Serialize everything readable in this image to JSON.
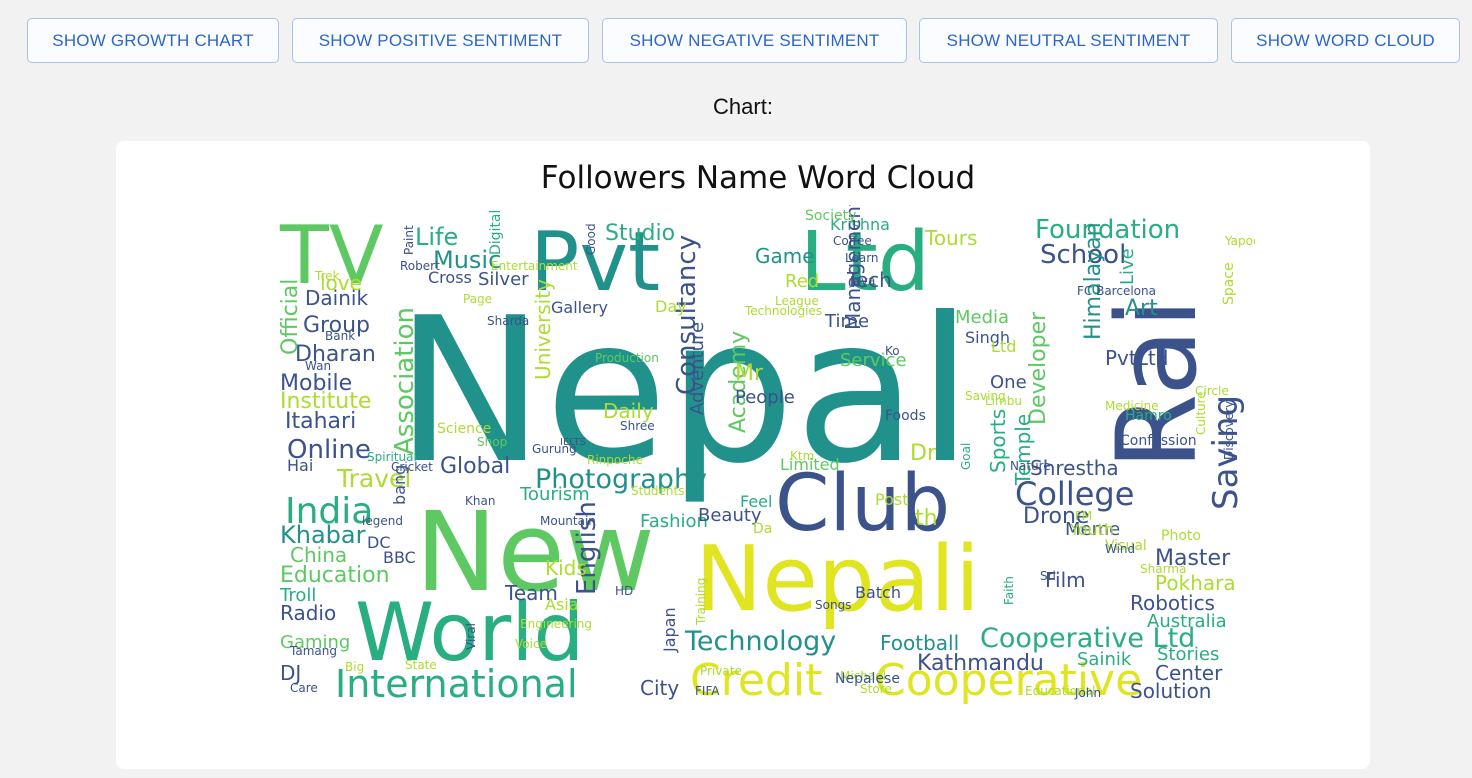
{
  "toolbar": {
    "buttons": [
      "SHOW GROWTH CHART",
      "SHOW POSITIVE SENTIMENT",
      "SHOW NEGATIVE SENTIMENT",
      "SHOW NEUTRAL SENTIMENT",
      "SHOW WORD CLOUD"
    ]
  },
  "chart_label": "Chart:",
  "wordcloud": {
    "title": "Followers Name Word Cloud",
    "palette": "viridis",
    "words": [
      "Nepal",
      "New",
      "Nepali",
      "Rai",
      "Pvt",
      "Ltd",
      "World",
      "TV",
      "Club",
      "International",
      "Cooperative",
      "Credit",
      "India",
      "College",
      "Saving",
      "Photography",
      "Technology",
      "Cooperative Ltd",
      "School",
      "Foundation",
      "Association",
      "Online",
      "Travel",
      "Life",
      "Music",
      "Studio",
      "Academy",
      "Tech",
      "Game",
      "Red",
      "Tours",
      "Krishna",
      "Developer",
      "Himalayan",
      "Art",
      "PvtLtd",
      "Shrestha",
      "Drone",
      "Meme",
      "Master",
      "Film",
      "Pokhara",
      "Robotics",
      "Australia",
      "Kathmandu",
      "Football",
      "Sainik",
      "Stories",
      "Center",
      "Solution",
      "City",
      "Team",
      "Radio",
      "Troll",
      "Gaming",
      "DJ",
      "Education",
      "China",
      "Khabar",
      "BBC",
      "Group",
      "Dharan",
      "Mobile",
      "Institute",
      "Itahari",
      "Global",
      "Dainik",
      "Official",
      "Tourism",
      "Fashion",
      "Beauty",
      "Feel",
      "Post",
      "Dr",
      "Limited",
      "People",
      "Management",
      "Time",
      "Service",
      "Media",
      "Singh",
      "One",
      "Ltd",
      "Consultancy",
      "Adventure",
      "Daily",
      "University",
      "Gallery",
      "Silver",
      "Cross",
      "Day",
      "Youth",
      "Photo",
      "Visual",
      "Temple",
      "Sports",
      "Asia",
      "English",
      "Kids",
      "love",
      "Confession",
      "Live",
      "Hamro",
      "Foods",
      "Limbu",
      "Digital",
      "Trek",
      "Paint",
      "Robert",
      "Entertainment",
      "Page",
      "Sharda",
      "Bank",
      "Wan",
      "Production",
      "Science",
      "Shop",
      "Gurung",
      "Rinpoche",
      "Students",
      "Spiritual",
      "Cricket",
      "Hai",
      "bang",
      "legend",
      "Mountain",
      "Khan",
      "DC",
      "Da",
      "Songs",
      "Batch",
      "HD",
      "Japan",
      "Training",
      "Engineering",
      "Voice",
      "Viral",
      "Tamang",
      "Big",
      "State",
      "Care",
      "FIFA",
      "Store",
      "Educational",
      "John",
      "Private",
      "Michael",
      "Nepalese",
      "Wind",
      "FM",
      "Sharma",
      "Faith",
      "Culture",
      "Discovery",
      "Circle",
      "Medicine",
      "Space",
      "Yapoo",
      "FC Barcelona",
      "League",
      "Technologies",
      "Society",
      "Coffee",
      "Learn",
      "Good",
      "Ktm",
      "Nature",
      "Goal",
      "Saving",
      "Shree",
      "Sri",
      "IELTS",
      "Ko",
      "Mr",
      "Jaya",
      "th",
      "v",
      "P",
      "D",
      "U"
    ]
  }
}
